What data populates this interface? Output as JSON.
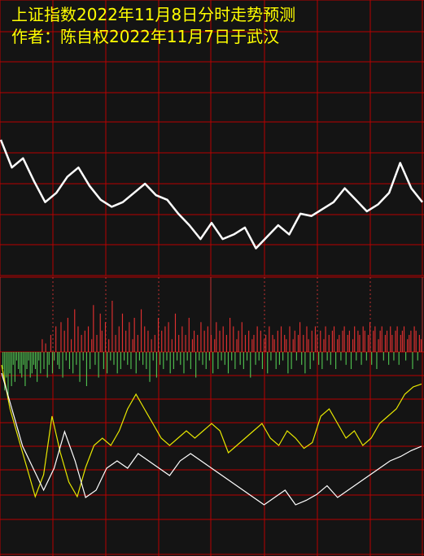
{
  "title_line1": "上证指数2022年11月8日分时走势预测",
  "title_line2": "作者：陈自权2022年11月7日于武汉",
  "colors": {
    "background": "#141414",
    "grid": "#b80000",
    "dotted_grid": "#c03030",
    "title": "#ffff00",
    "price_line": "#ffffff",
    "up_bar": "#e03030",
    "down_bar": "#50c050",
    "yellow_line": "#e8e800",
    "white_line": "#ffffff"
  },
  "chart_data": [
    {
      "type": "line",
      "panel": "intraday-price",
      "grid": true,
      "series": [
        {
          "color": "#ffffff",
          "points": [
            [
              0,
              0.3
            ],
            [
              1,
              0.42
            ],
            [
              2,
              0.38
            ],
            [
              3,
              0.48
            ],
            [
              4,
              0.57
            ],
            [
              5,
              0.53
            ],
            [
              6,
              0.46
            ],
            [
              7,
              0.42
            ],
            [
              8,
              0.5
            ],
            [
              9,
              0.56
            ],
            [
              10,
              0.59
            ],
            [
              11,
              0.57
            ],
            [
              12,
              0.53
            ],
            [
              13,
              0.49
            ],
            [
              14,
              0.54
            ],
            [
              15,
              0.56
            ],
            [
              16,
              0.62
            ],
            [
              17,
              0.67
            ],
            [
              18,
              0.73
            ],
            [
              19,
              0.66
            ],
            [
              20,
              0.73
            ],
            [
              21,
              0.71
            ],
            [
              22,
              0.68
            ],
            [
              23,
              0.77
            ],
            [
              24,
              0.72
            ],
            [
              25,
              0.67
            ],
            [
              26,
              0.71
            ],
            [
              27,
              0.62
            ],
            [
              28,
              0.63
            ],
            [
              29,
              0.6
            ],
            [
              30,
              0.57
            ],
            [
              31,
              0.51
            ],
            [
              32,
              0.56
            ],
            [
              33,
              0.61
            ],
            [
              34,
              0.58
            ],
            [
              35,
              0.53
            ],
            [
              36,
              0.4
            ],
            [
              37,
              0.51
            ],
            [
              38,
              0.57
            ]
          ]
        }
      ]
    },
    {
      "type": "bar",
      "panel": "net-flow-bars",
      "description_values": "positive = red (up), negative = green (down)",
      "values": [
        0,
        -20,
        -45,
        -30,
        -55,
        -25,
        -40,
        -15,
        -35,
        -10,
        -20,
        -25,
        -30,
        -15,
        -40,
        -20,
        -10,
        -30,
        -25,
        -15,
        -20,
        -35,
        -10,
        -25,
        15,
        -20,
        10,
        -30,
        -15,
        20,
        -25,
        -10,
        30,
        -15,
        -20,
        35,
        -30,
        25,
        -10,
        40,
        -20,
        15,
        -25,
        50,
        -15,
        30,
        -35,
        20,
        -10,
        25,
        -40,
        30,
        -20,
        15,
        55,
        -15,
        20,
        -30,
        45,
        25,
        -20,
        35,
        -25,
        15,
        -10,
        60,
        -15,
        20,
        -25,
        30,
        -20,
        45,
        -10,
        25,
        -15,
        35,
        -20,
        15,
        40,
        -25,
        20,
        -10,
        50,
        -15,
        30,
        -20,
        25,
        -35,
        15,
        -10,
        20,
        -30,
        40,
        -15,
        25,
        -20,
        30,
        -10,
        35,
        -25,
        15,
        -20,
        45,
        -10,
        20,
        -15,
        30,
        -25,
        20,
        -10,
        40,
        -20,
        15,
        25,
        -30,
        20,
        -10,
        35,
        -15,
        25,
        -20,
        30,
        -10,
        20,
        -25,
        15,
        35,
        -20,
        25,
        -10,
        30,
        -15,
        20,
        -25,
        40,
        -10,
        30,
        -20,
        15,
        25,
        -15,
        35,
        -20,
        20,
        -10,
        25,
        -30,
        15,
        20,
        -15,
        30,
        -10,
        25,
        -20,
        15,
        20,
        -25,
        30,
        -10,
        20,
        15,
        -20,
        25,
        -15,
        30,
        -10,
        20,
        15,
        -25,
        30,
        -20,
        15,
        25,
        -10,
        20,
        35,
        -15,
        20,
        -25,
        30,
        15,
        -20,
        25,
        -10,
        30,
        20,
        -15,
        25,
        -20,
        15,
        30,
        -10,
        20,
        -15,
        25,
        30,
        -20,
        15,
        20,
        -10,
        25,
        30,
        -15,
        20,
        25,
        -20,
        15,
        30,
        -10,
        25,
        20,
        -15,
        30,
        25,
        -10,
        20,
        35,
        -15,
        25,
        30,
        -20,
        15,
        25,
        30,
        -10,
        20,
        25,
        -15,
        30,
        20,
        -10,
        25,
        30,
        -15,
        20,
        25,
        30,
        -10,
        15,
        20,
        25,
        -20,
        30,
        25,
        -10,
        20,
        15
      ]
    },
    {
      "type": "line",
      "panel": "indicator-lines",
      "series": [
        {
          "color": "#e8e800",
          "points": [
            [
              0,
              0.05
            ],
            [
              1,
              0.35
            ],
            [
              2,
              0.55
            ],
            [
              3,
              0.75
            ],
            [
              4,
              0.95
            ],
            [
              5,
              0.8
            ],
            [
              6,
              0.4
            ],
            [
              7,
              0.65
            ],
            [
              8,
              0.85
            ],
            [
              9,
              0.95
            ],
            [
              10,
              0.75
            ],
            [
              11,
              0.6
            ],
            [
              12,
              0.55
            ],
            [
              13,
              0.6
            ],
            [
              14,
              0.5
            ],
            [
              15,
              0.35
            ],
            [
              16,
              0.25
            ],
            [
              17,
              0.35
            ],
            [
              18,
              0.45
            ],
            [
              19,
              0.55
            ],
            [
              20,
              0.6
            ],
            [
              21,
              0.55
            ],
            [
              22,
              0.5
            ],
            [
              23,
              0.55
            ],
            [
              24,
              0.5
            ],
            [
              25,
              0.45
            ],
            [
              26,
              0.5
            ],
            [
              27,
              0.65
            ],
            [
              28,
              0.6
            ],
            [
              29,
              0.55
            ],
            [
              30,
              0.5
            ],
            [
              31,
              0.45
            ],
            [
              32,
              0.55
            ],
            [
              33,
              0.6
            ],
            [
              34,
              0.5
            ],
            [
              35,
              0.55
            ],
            [
              36,
              0.62
            ],
            [
              37,
              0.58
            ],
            [
              38,
              0.4
            ],
            [
              39,
              0.35
            ],
            [
              40,
              0.45
            ],
            [
              41,
              0.55
            ],
            [
              42,
              0.5
            ],
            [
              43,
              0.6
            ],
            [
              44,
              0.55
            ],
            [
              45,
              0.45
            ],
            [
              46,
              0.4
            ],
            [
              47,
              0.35
            ],
            [
              48,
              0.25
            ],
            [
              49,
              0.2
            ],
            [
              50,
              0.18
            ]
          ]
        },
        {
          "color": "#ffffff",
          "points": [
            [
              0,
              0.05
            ],
            [
              1,
              0.3
            ],
            [
              2,
              0.55
            ],
            [
              3,
              0.7
            ],
            [
              4,
              0.85
            ],
            [
              5,
              0.7
            ],
            [
              6,
              0.45
            ],
            [
              7,
              0.65
            ],
            [
              8,
              0.9
            ],
            [
              9,
              0.85
            ],
            [
              10,
              0.7
            ],
            [
              11,
              0.65
            ],
            [
              12,
              0.7
            ],
            [
              13,
              0.6
            ],
            [
              14,
              0.65
            ],
            [
              15,
              0.7
            ],
            [
              16,
              0.75
            ],
            [
              17,
              0.65
            ],
            [
              18,
              0.6
            ],
            [
              19,
              0.65
            ],
            [
              20,
              0.7
            ],
            [
              21,
              0.75
            ],
            [
              22,
              0.8
            ],
            [
              23,
              0.85
            ],
            [
              24,
              0.9
            ],
            [
              25,
              0.95
            ],
            [
              26,
              0.9
            ],
            [
              27,
              0.85
            ],
            [
              28,
              0.95
            ],
            [
              29,
              0.92
            ],
            [
              30,
              0.88
            ],
            [
              31,
              0.82
            ],
            [
              32,
              0.9
            ],
            [
              33,
              0.85
            ],
            [
              34,
              0.8
            ],
            [
              35,
              0.75
            ],
            [
              36,
              0.7
            ],
            [
              37,
              0.65
            ],
            [
              38,
              0.62
            ],
            [
              39,
              0.58
            ],
            [
              40,
              0.55
            ]
          ]
        }
      ]
    }
  ]
}
